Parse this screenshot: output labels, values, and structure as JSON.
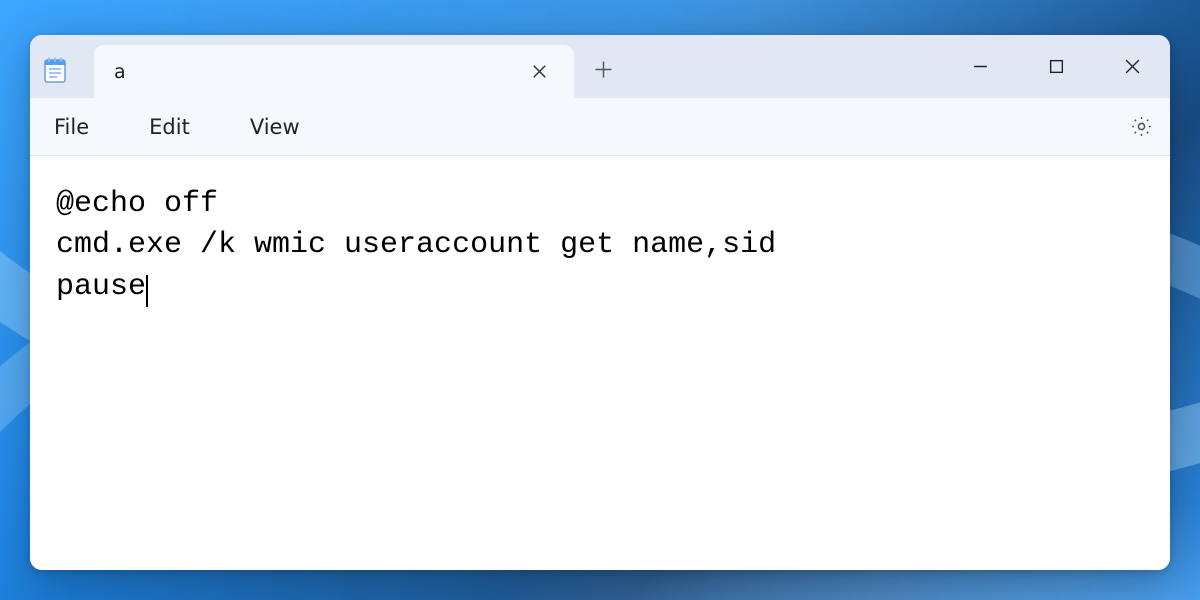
{
  "window": {
    "tab_title": "a",
    "menu": {
      "file": "File",
      "edit": "Edit",
      "view": "View"
    }
  },
  "editor": {
    "line1": "@echo off",
    "line2": "cmd.exe /k wmic useraccount get name,sid",
    "line3": "pause"
  }
}
